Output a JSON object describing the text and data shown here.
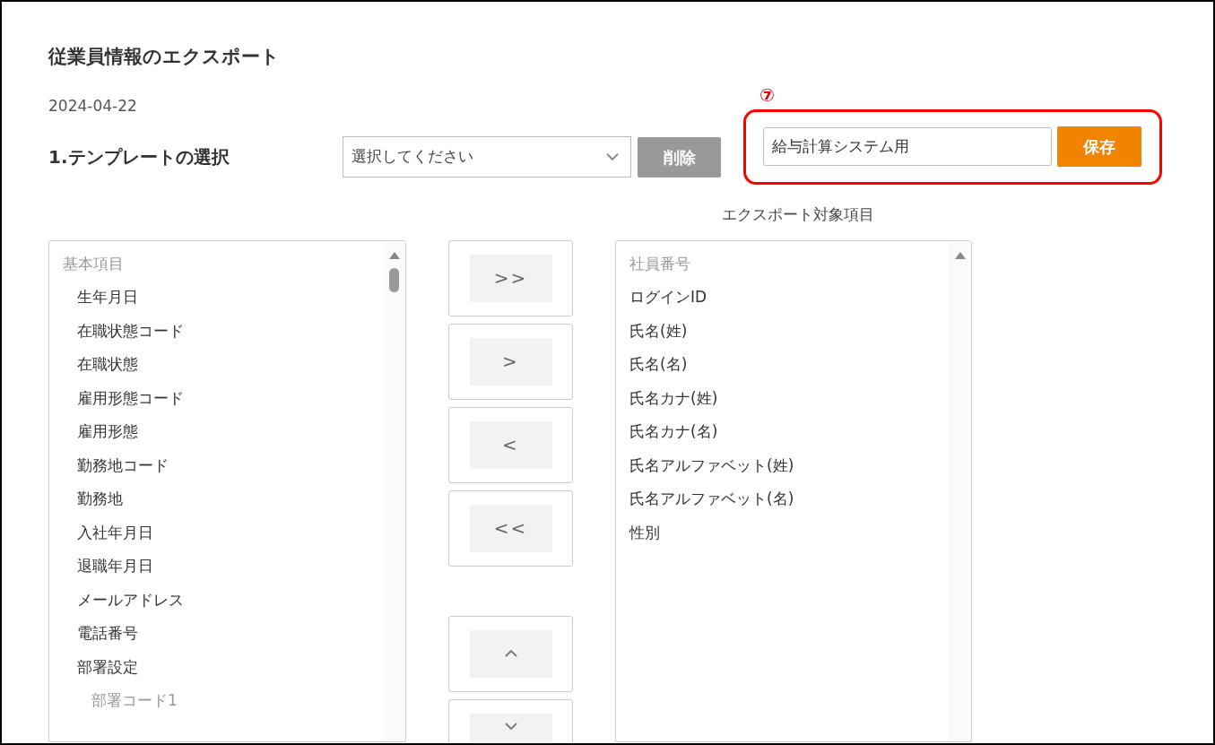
{
  "page": {
    "title": "従業員情報のエクスポート",
    "date": "2024-04-22"
  },
  "template": {
    "section_label": "1.テンプレートの選択",
    "select": {
      "value": "選択してください"
    },
    "delete_button": "削除",
    "name_field": {
      "value": "給与計算システム用"
    },
    "save_button": "保存"
  },
  "annotation": {
    "label": "⑦"
  },
  "available_items": [
    {
      "label": "基本項目",
      "children": [
        {
          "label": "生年月日"
        },
        {
          "label": "在職状態コード"
        },
        {
          "label": "在職状態"
        },
        {
          "label": "雇用形態コード"
        },
        {
          "label": "雇用形態"
        },
        {
          "label": "勤務地コード"
        },
        {
          "label": "勤務地"
        },
        {
          "label": "入社年月日"
        },
        {
          "label": "退職年月日"
        },
        {
          "label": "メールアドレス"
        },
        {
          "label": "電話番号"
        },
        {
          "label": "部署設定",
          "children": [
            {
              "label": "部署コード1"
            }
          ]
        }
      ]
    }
  ],
  "move_buttons": [
    {
      "kind": "text",
      "label": ">>"
    },
    {
      "kind": "text",
      "label": ">"
    },
    {
      "kind": "text",
      "label": "<"
    },
    {
      "kind": "text",
      "label": "<<"
    },
    {
      "kind": "spacer"
    },
    {
      "kind": "up"
    },
    {
      "kind": "down"
    }
  ],
  "export_items": {
    "heading": "エクスポート対象項目",
    "items": [
      {
        "label": "社員番号",
        "disabled": true
      },
      {
        "label": "ログインID",
        "disabled": false
      },
      {
        "label": "氏名(姓)",
        "disabled": false
      },
      {
        "label": "氏名(名)",
        "disabled": false
      },
      {
        "label": "氏名カナ(姓)",
        "disabled": false
      },
      {
        "label": "氏名カナ(名)",
        "disabled": false
      },
      {
        "label": "氏名アルファベット(姓)",
        "disabled": false
      },
      {
        "label": "氏名アルファベット(名)",
        "disabled": false
      },
      {
        "label": "性別",
        "disabled": false
      }
    ]
  }
}
